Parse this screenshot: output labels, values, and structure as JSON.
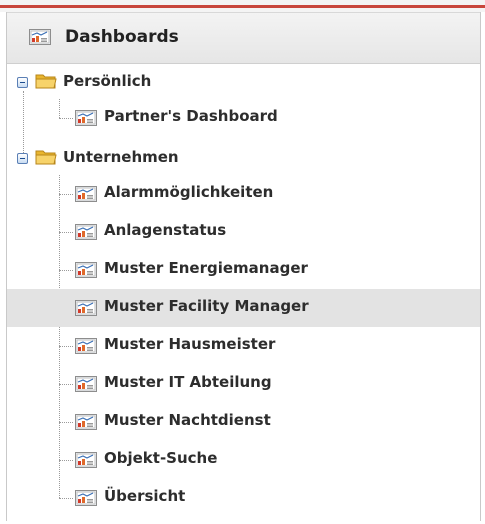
{
  "header": {
    "title": "Dashboards"
  },
  "tree": {
    "groups": [
      {
        "label": "Persönlich",
        "items": [
          {
            "label": "Partner's Dashboard"
          }
        ]
      },
      {
        "label": "Unternehmen",
        "items": [
          {
            "label": "Alarmmöglichkeiten"
          },
          {
            "label": "Anlagenstatus"
          },
          {
            "label": "Muster Energiemanager"
          },
          {
            "label": "Muster Facility Manager"
          },
          {
            "label": "Muster Hausmeister"
          },
          {
            "label": "Muster IT Abteilung"
          },
          {
            "label": "Muster Nachtdienst"
          },
          {
            "label": "Objekt-Suche"
          },
          {
            "label": "Übersicht"
          }
        ]
      }
    ],
    "selected_item": "Muster Facility Manager"
  },
  "colors": {
    "accent_bar": "#c8463c",
    "selected_row": "#e3e3e3",
    "folder": "#f4c542",
    "toggle_border": "#5a7fb5"
  },
  "icons": {
    "header": "dashboard-icon",
    "group": "folder-open-icon",
    "item": "dashboard-icon",
    "toggle": "collapse-toggle-icon"
  }
}
